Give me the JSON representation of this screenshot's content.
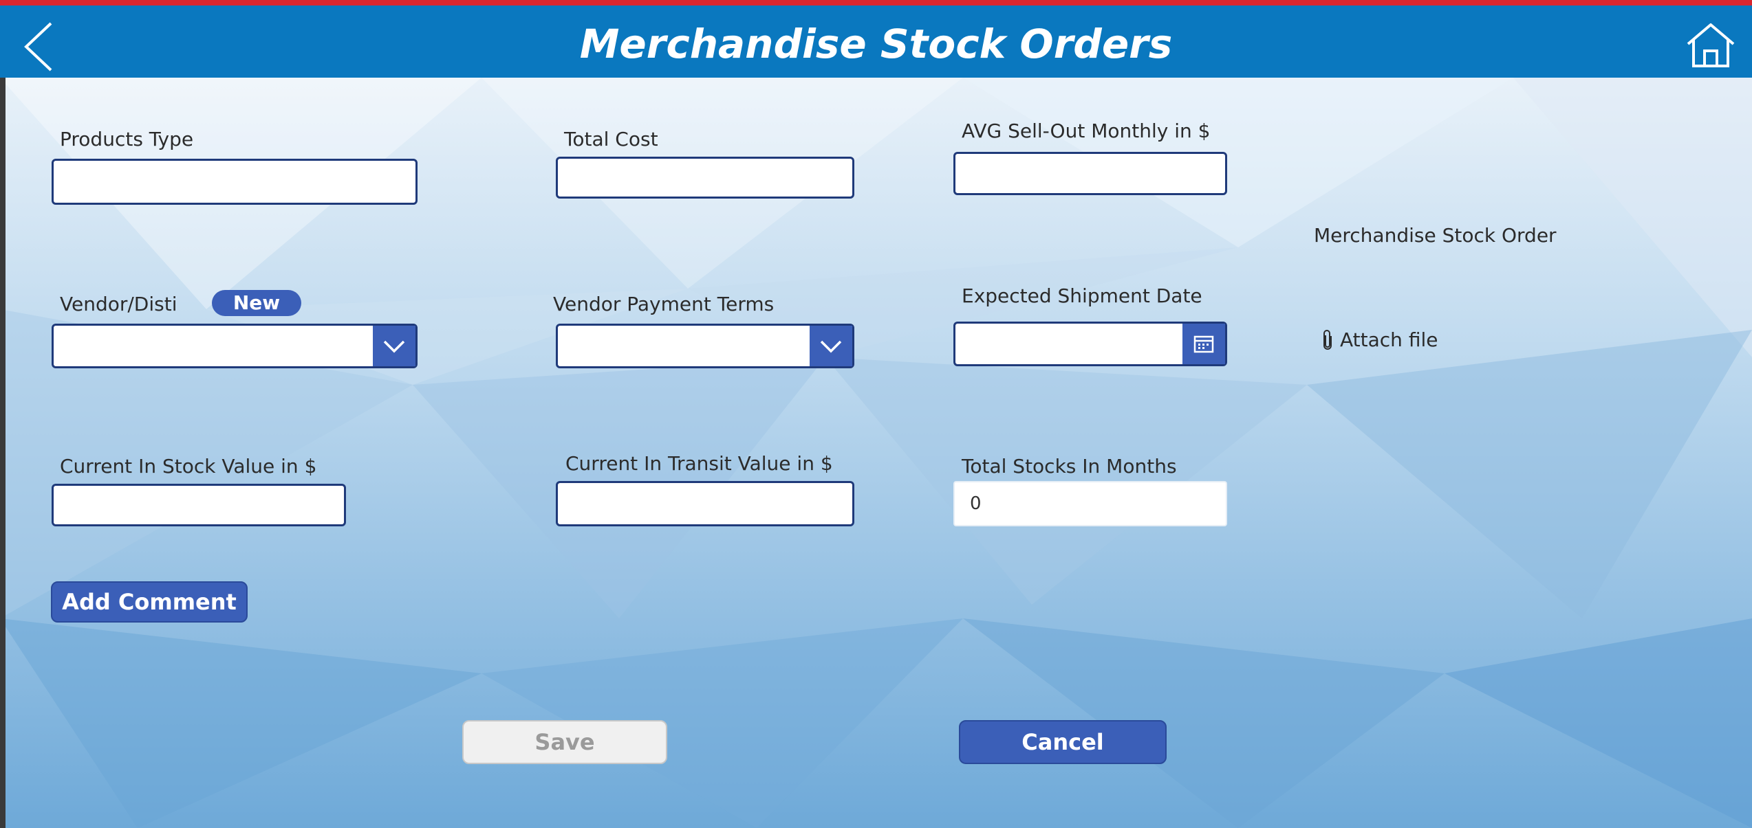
{
  "header": {
    "title": "Merchandise Stock Orders",
    "back_icon": "chevron-left-icon",
    "home_icon": "home-icon"
  },
  "form": {
    "products_type": {
      "label": "Products Type",
      "value": ""
    },
    "total_cost": {
      "label": "Total Cost",
      "value": ""
    },
    "avg_sell_out": {
      "label": "AVG Sell-Out Monthly in $",
      "value": ""
    },
    "vendor_disti": {
      "label": "Vendor/Disti",
      "new_badge": "New",
      "value": ""
    },
    "vendor_payment_terms": {
      "label": "Vendor Payment Terms",
      "value": ""
    },
    "expected_shipment_date": {
      "label": "Expected Shipment Date",
      "value": ""
    },
    "current_in_stock": {
      "label": "Current In Stock Value in $",
      "value": ""
    },
    "current_in_transit": {
      "label": "Current In Transit Value in $",
      "value": ""
    },
    "total_stocks_months": {
      "label": "Total Stocks In Months",
      "value": "0"
    }
  },
  "attachments": {
    "label": "Merchandise Stock Order",
    "attach_label": "Attach file",
    "attach_icon": "paperclip-icon"
  },
  "buttons": {
    "add_comment": "Add Comment",
    "save": "Save",
    "cancel": "Cancel"
  },
  "colors": {
    "header_bg": "#0a78bf",
    "accent_red": "#d9262e",
    "button_primary": "#3b5fb8",
    "input_border": "#1f3a7a"
  }
}
